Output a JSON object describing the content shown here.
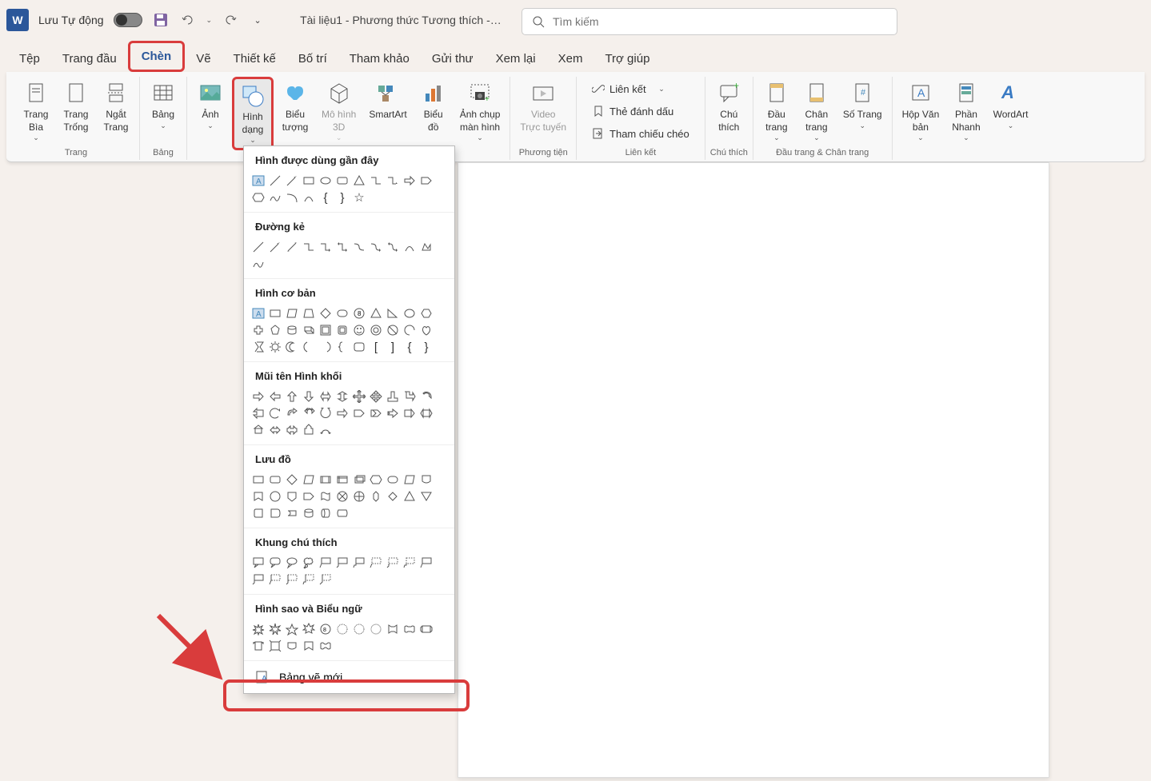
{
  "titlebar": {
    "autosave": "Lưu Tự động",
    "doc_title": "Tài liệu1  -  Phương thức Tương thích  -…",
    "search_placeholder": "Tìm kiếm"
  },
  "tabs": {
    "file": "Tệp",
    "home": "Trang đầu",
    "insert": "Chèn",
    "draw": "Vẽ",
    "design": "Thiết kế",
    "layout": "Bố trí",
    "references": "Tham khảo",
    "mailings": "Gửi thư",
    "review": "Xem lại",
    "view": "Xem",
    "help": "Trợ giúp"
  },
  "ribbon": {
    "pages": {
      "cover": "Trang\nBìa",
      "blank": "Trang\nTrống",
      "break": "Ngắt\nTrang",
      "group": "Trang"
    },
    "tables": {
      "table": "Bảng",
      "group": "Bảng"
    },
    "illus": {
      "pictures": "Ảnh",
      "shapes": "Hình\ndạng",
      "icons": "Biểu\ntượng",
      "models3d": "Mô hình\n3D",
      "smartart": "SmartArt",
      "chart": "Biểu\nđồ",
      "screenshot": "Ảnh chụp\nmàn hình"
    },
    "media": {
      "video": "Video\nTrực tuyến",
      "group": "Phương tiện"
    },
    "links": {
      "link": "Liên kết",
      "bookmark": "Thẻ đánh dấu",
      "crossref": "Tham chiếu chéo",
      "group": "Liên kết"
    },
    "comments": {
      "comment": "Chú\nthích",
      "group": "Chú thích"
    },
    "headerfooter": {
      "header": "Đầu\ntrang",
      "footer": "Chân\ntrang",
      "pagenum": "Số Trang",
      "group": "Đầu trang & Chân trang"
    },
    "text": {
      "textbox": "Hộp Văn\nbản",
      "quickparts": "Phần\nNhanh",
      "wordart": "WordArt"
    }
  },
  "shapes_menu": {
    "recent": "Hình được dùng gần đây",
    "lines": "Đường kẻ",
    "basic": "Hình cơ bản",
    "arrows": "Mũi tên Hình khối",
    "flowchart": "Lưu đồ",
    "callouts": "Khung chú thích",
    "stars": "Hình sao và Biểu ngữ",
    "new_canvas": "Bảng vẽ mới"
  }
}
